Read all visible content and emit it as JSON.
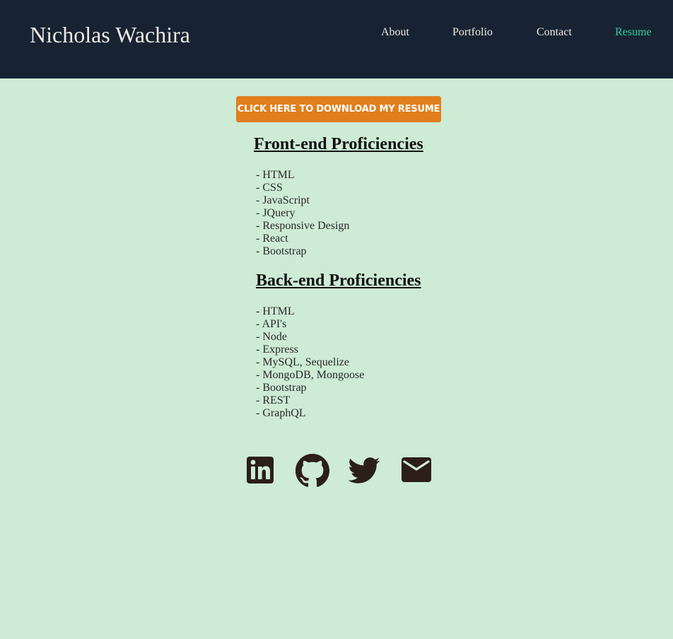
{
  "header": {
    "site_name": "Nicholas Wachira",
    "nav": [
      {
        "label": "About"
      },
      {
        "label": "Portfolio"
      },
      {
        "label": "Contact"
      },
      {
        "label": "Resume",
        "active": true
      }
    ]
  },
  "main": {
    "download_button": "CLICK HERE TO DOWNLOAD MY RESUME",
    "frontend": {
      "title": "Front-end Proficiencies",
      "items": [
        "- HTML",
        "- CSS",
        "- JavaScript",
        "- JQuery",
        "- Responsive Design",
        "- React",
        "- Bootstrap"
      ]
    },
    "backend": {
      "title": "Back-end Proficiencies",
      "items": [
        "- HTML",
        "- API's",
        "- Node",
        "- Express",
        "- MySQL, Sequelize",
        "- MongoDB, Mongoose",
        "- Bootstrap",
        "- REST",
        "- GraphQL"
      ]
    }
  },
  "social": [
    {
      "icon": "linkedin-icon"
    },
    {
      "icon": "github-icon"
    },
    {
      "icon": "twitter-icon"
    },
    {
      "icon": "email-icon"
    }
  ],
  "colors": {
    "background": "#cdebd5",
    "header": "#172333",
    "accent": "#2fcfa2",
    "button": "#e07f1c",
    "icon": "#2c1e18"
  }
}
